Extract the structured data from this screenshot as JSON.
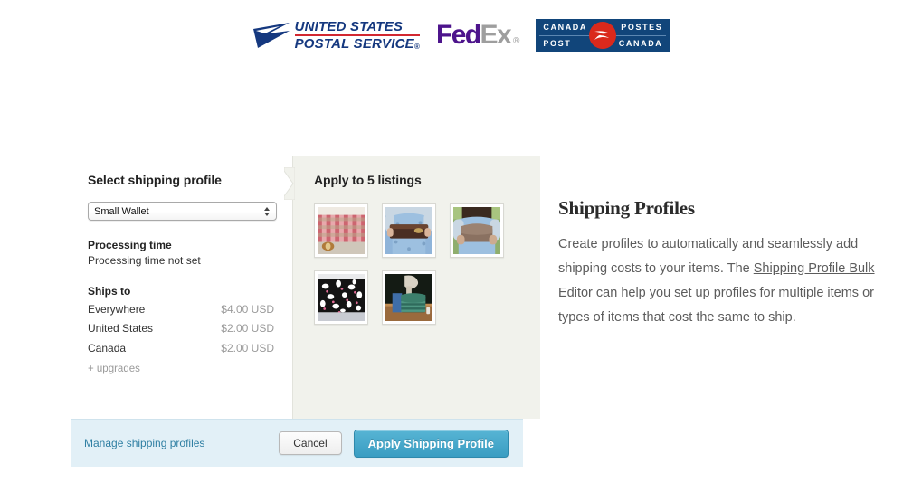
{
  "carriers": [
    {
      "id": "usps",
      "name": "United States Postal Service",
      "line1": "UNITED STATES",
      "line2": "POSTAL SERVICE",
      "registered": "®"
    },
    {
      "id": "fedex",
      "name": "FedEx",
      "part1": "Fed",
      "part2": "Ex",
      "registered": "®"
    },
    {
      "id": "canada-post",
      "name": "Canada Post",
      "cell_tl": "CANADA",
      "cell_tr": "POSTES",
      "cell_bl": "POST",
      "cell_br": "CANADA"
    }
  ],
  "dialog": {
    "profile_panel": {
      "heading": "Select shipping profile",
      "select": {
        "value": "Small Wallet",
        "options": [
          "Small Wallet"
        ]
      },
      "processing_time_label": "Processing time",
      "processing_time_value": "Processing time not set",
      "ships_to_label": "Ships to",
      "ships_to": [
        {
          "destination": "Everywhere",
          "price": "$4.00 USD"
        },
        {
          "destination": "United States",
          "price": "$2.00 USD"
        },
        {
          "destination": "Canada",
          "price": "$2.00 USD"
        }
      ],
      "upgrades_label": "+ upgrades"
    },
    "listings_panel": {
      "heading": "Apply to 5 listings",
      "listings": [
        {
          "alt": "Wallet on pink gingham fabric backdrop"
        },
        {
          "alt": "Person holding dark brown long wallet"
        },
        {
          "alt": "Person holding taupe clutch wallet"
        },
        {
          "alt": "Black and white floral print clutch"
        },
        {
          "alt": "Teal striped wallet on wooden table"
        }
      ]
    },
    "footer": {
      "manage_label": "Manage shipping profiles",
      "cancel_label": "Cancel",
      "apply_label": "Apply Shipping Profile"
    }
  },
  "help": {
    "title": "Shipping Profiles",
    "text_before": "Create profiles to automatically and seamlessly add shipping costs to your items. The ",
    "link_label": "Shipping Profile Bulk Editor",
    "text_after": " can help you set up profiles for multiple items or types of items that cost the same to ship."
  },
  "colors": {
    "usps_blue": "#15387F",
    "usps_red": "#D22730",
    "fedex_purple": "#4D148C",
    "fedex_grey": "#9E9E9E",
    "canada_post_blue": "#11457A",
    "canada_post_red": "#DA291C",
    "panel_grey_green": "#f1f2ec",
    "footer_blue": "#e2f0f7",
    "apply_button_teal": "#3a9dc2",
    "link_teal": "#2f7fa3"
  }
}
